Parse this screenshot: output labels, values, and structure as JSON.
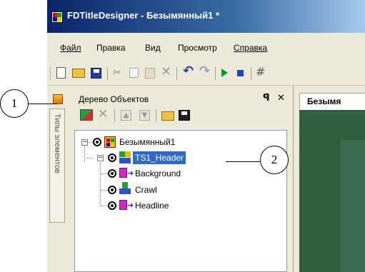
{
  "window": {
    "title": "FDTitleDesigner - Безымянный1 *"
  },
  "menu": [
    "Файл",
    "Правка",
    "Вид",
    "Просмотр",
    "Справка"
  ],
  "panel": {
    "title": "Дерево Объектов",
    "pin": "ᵽ",
    "close": "✕"
  },
  "side_tab": {
    "label": "Типы элементов"
  },
  "doc_tab": {
    "label": "Безымя"
  },
  "tree": {
    "root": "Безымянный1",
    "header": "TS1_Header",
    "children": [
      "Background",
      "Crawl",
      "Headline"
    ]
  },
  "callouts": {
    "one": "1",
    "two": "2"
  },
  "colors": {
    "titlebar_start": "#0a246a",
    "titlebar_end": "#3a6ea5",
    "selection": "#316ac5",
    "canvas": "#2f5f3d"
  }
}
